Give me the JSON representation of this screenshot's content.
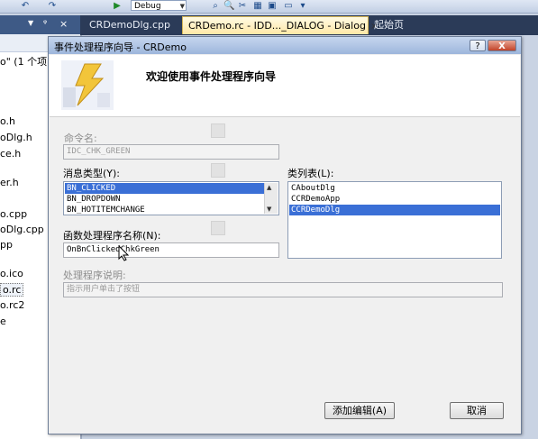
{
  "ide": {
    "config_combo": "Debug",
    "tabs": [
      {
        "label": "CRDemoDlg.cpp",
        "active": false
      },
      {
        "label": "CRDemo.rc - IDD..._DIALOG - Dialog",
        "active": true,
        "close": "×"
      },
      {
        "label": "起始页",
        "active": false
      }
    ],
    "left_panel": {
      "header_pin": "ᵠ",
      "header_close": "×",
      "solution_line": "o\" (1 个项目",
      "items": [
        "o.h",
        "oDlg.h",
        "ce.h",
        "er.h",
        "o.cpp",
        "oDlg.cpp",
        "pp",
        "o.ico",
        "o.rc",
        "o.rc2",
        "e"
      ]
    }
  },
  "dialog": {
    "title": "事件处理程序向导 - CRDemo",
    "help_label": "?",
    "close_label": "X",
    "heading": "欢迎使用事件处理程序向导",
    "command_name_label": "命令名:",
    "command_name_value": "IDC_CHK_GREEN",
    "message_type_label": "消息类型(Y):",
    "message_types": [
      "BN_CLICKED",
      "BN_DROPDOWN",
      "BN_HOTITEMCHANGE"
    ],
    "message_selected": "BN_CLICKED",
    "class_list_label": "类列表(L):",
    "classes": [
      "CAboutDlg",
      "CCRDemoApp",
      "CCRDemoDlg"
    ],
    "class_selected": "CCRDemoDlg",
    "handler_name_label": "函数处理程序名称(N):",
    "handler_name_value": "OnBnClickedChkGreen",
    "handler_desc_label": "处理程序说明:",
    "handler_desc_value": "指示用户单击了按钮",
    "add_edit_button": "添加编辑(A)",
    "cancel_button": "取消"
  },
  "colors": {
    "selection": "#3a6fd6",
    "tab_active": "#ffe8a6",
    "ide_dark": "#2b3b58"
  }
}
